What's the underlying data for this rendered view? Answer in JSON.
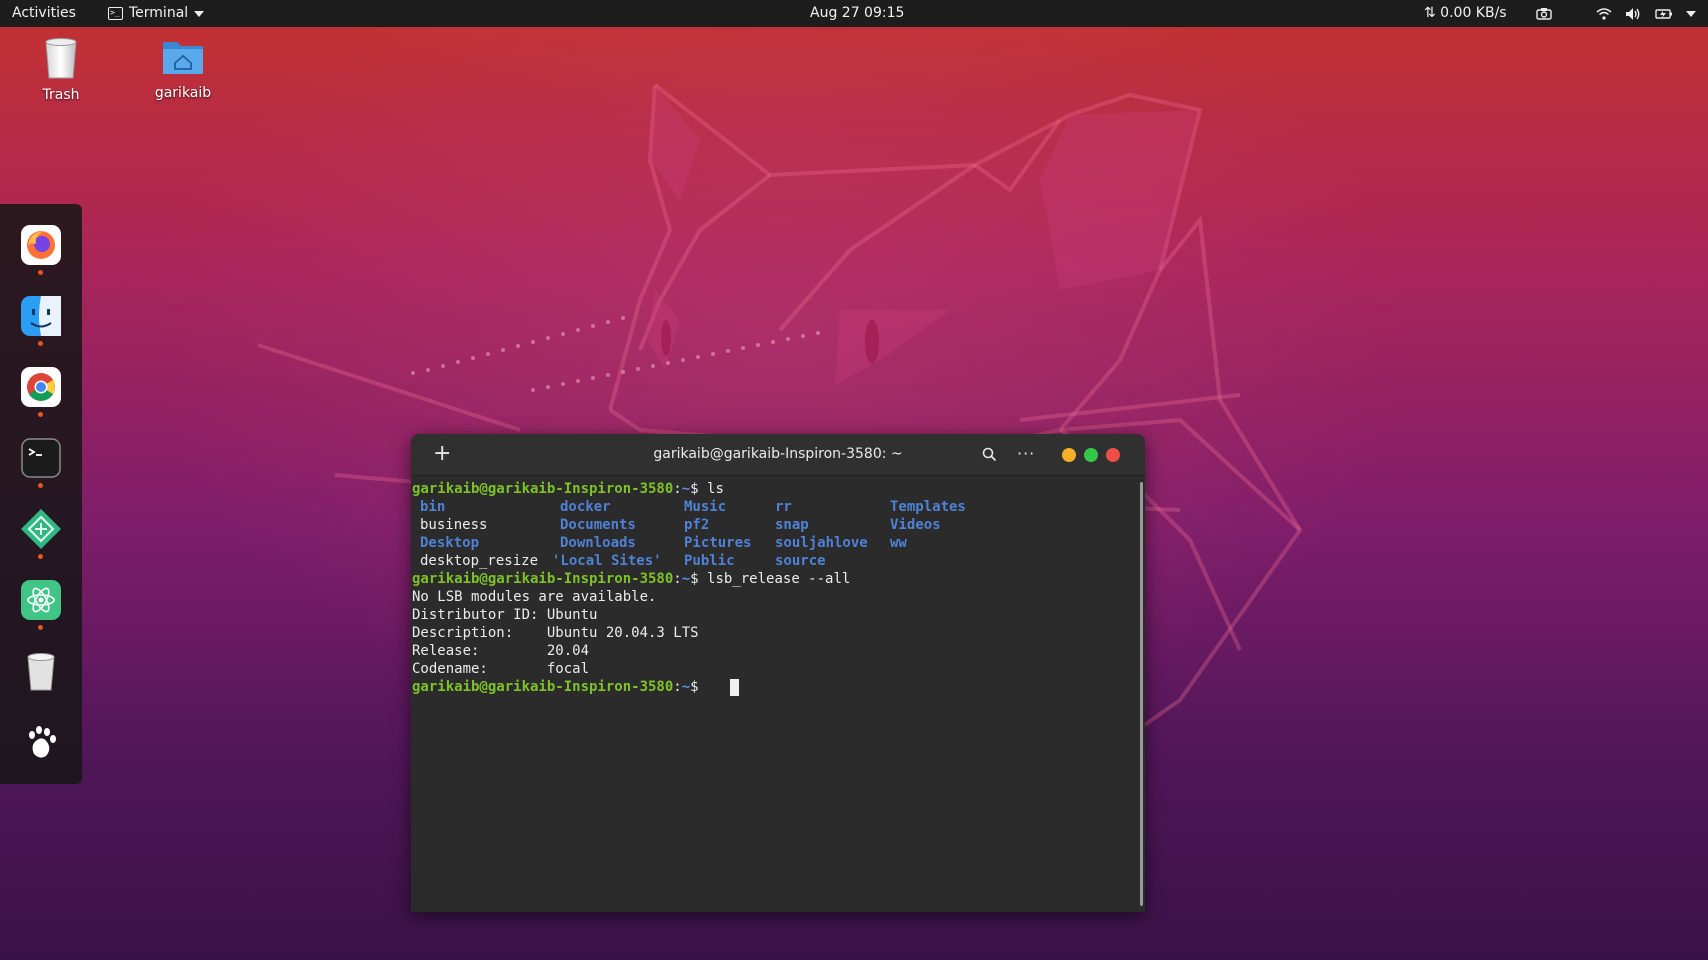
{
  "topbar": {
    "activities": "Activities",
    "app_name": "Terminal",
    "clock": "Aug 27  09:15",
    "net_speed": "⇅ 0.00 KB/s",
    "tray_icons": [
      "screenshot-icon",
      "wifi-icon",
      "volume-icon",
      "battery-icon",
      "system-menu-caret-icon"
    ]
  },
  "desktop": {
    "icons": [
      {
        "label": "Trash",
        "icon": "trash-icon"
      },
      {
        "label": "garikaib",
        "icon": "home-folder-icon"
      }
    ]
  },
  "dock": {
    "apps": [
      {
        "name": "firefox-icon",
        "running": true
      },
      {
        "name": "finder-face-icon",
        "running": true
      },
      {
        "name": "chrome-icon",
        "running": true
      },
      {
        "name": "terminal-icon",
        "running": true
      },
      {
        "name": "diamond-app-icon",
        "running": true
      },
      {
        "name": "atom-icon",
        "running": true
      },
      {
        "name": "trash-icon",
        "running": false
      },
      {
        "name": "gimp-paw-icon",
        "running": false
      }
    ]
  },
  "terminal": {
    "title": "garikaib@garikaib-Inspiron-3580: ~",
    "new_tab_glyph": "+",
    "menu_glyph": "···",
    "prompt_user": "garikaib@garikaib-Inspiron-3580",
    "prompt_sep": ":",
    "prompt_path": "~",
    "prompt_symbol": "$",
    "cmd1": " ls",
    "ls_output": [
      [
        {
          "t": "bin",
          "d": true
        },
        {
          "t": "docker",
          "d": true
        },
        {
          "t": "Music",
          "d": true
        },
        {
          "t": "rr",
          "d": true
        },
        {
          "t": "Templates",
          "d": true
        }
      ],
      [
        {
          "t": "business",
          "d": false
        },
        {
          "t": "Documents",
          "d": true
        },
        {
          "t": "pf2",
          "d": true
        },
        {
          "t": "snap",
          "d": true
        },
        {
          "t": "Videos",
          "d": true
        }
      ],
      [
        {
          "t": "Desktop",
          "d": true
        },
        {
          "t": "Downloads",
          "d": true
        },
        {
          "t": "Pictures",
          "d": true
        },
        {
          "t": "souljahlove",
          "d": true
        },
        {
          "t": "ww",
          "d": true
        }
      ],
      [
        {
          "t": "desktop_resize",
          "d": false
        },
        {
          "t": "'Local Sites'",
          "d": true
        },
        {
          "t": "Public",
          "d": true
        },
        {
          "t": "source",
          "d": true
        },
        {
          "t": "",
          "d": false
        }
      ]
    ],
    "cmd2": " lsb_release --all",
    "output2": [
      "No LSB modules are available.",
      "Distributor ID: Ubuntu",
      "Description:    Ubuntu 20.04.3 LTS",
      "Release:        20.04",
      "Codename:       focal"
    ]
  },
  "colors": {
    "prompt_user": "#7ec228",
    "directory": "#4f82d6",
    "accent_orange": "#e95420"
  }
}
